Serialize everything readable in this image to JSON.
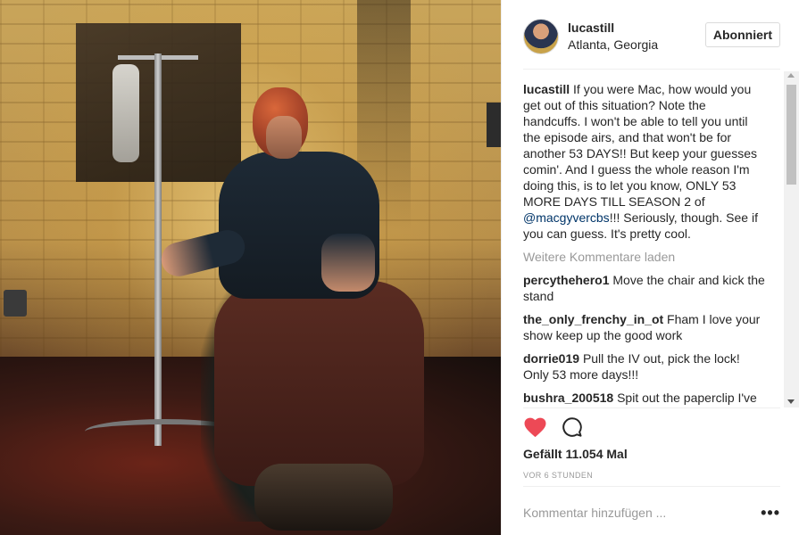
{
  "post": {
    "username": "lucastill",
    "location": "Atlanta, Georgia",
    "follow_label": "Abonniert",
    "caption": {
      "user": "lucastill",
      "text_before": "If you were Mac, how would you get out of this situation? Note the handcuffs. I won't be able to tell you until the episode airs, and that won't be for another 53 DAYS!! But keep your guesses comin'. And I guess the whole reason I'm doing this, is to let you know, ONLY 53 MORE DAYS TILL SEASON 2 of",
      "mention": "@macgyvercbs",
      "text_after": "!!! Seriously, though. See if you can guess. It's pretty cool."
    },
    "load_more_label": "Weitere Kommentare laden",
    "comments": [
      {
        "user": "percythehero1",
        "text": "Move the chair and kick the stand"
      },
      {
        "user": "the_only_frenchy_in_ot",
        "text": "Fham I love your show keep up the good work"
      },
      {
        "user": "dorrie019",
        "text": "Pull the IV out, pick the lock! Only 53 more days!!!"
      },
      {
        "user": "bushra_200518",
        "text": "Spit out the paperclip I've been hiding and pick the lock"
      }
    ],
    "likes_label": "Gefällt 11.054 Mal",
    "timestamp": "VOR 6 STUNDEN",
    "comment_placeholder": "Kommentar hinzufügen ...",
    "more_options": "•••",
    "liked": true,
    "colors": {
      "heart": "#ed4956",
      "mention": "#003569",
      "muted": "#999999"
    }
  }
}
